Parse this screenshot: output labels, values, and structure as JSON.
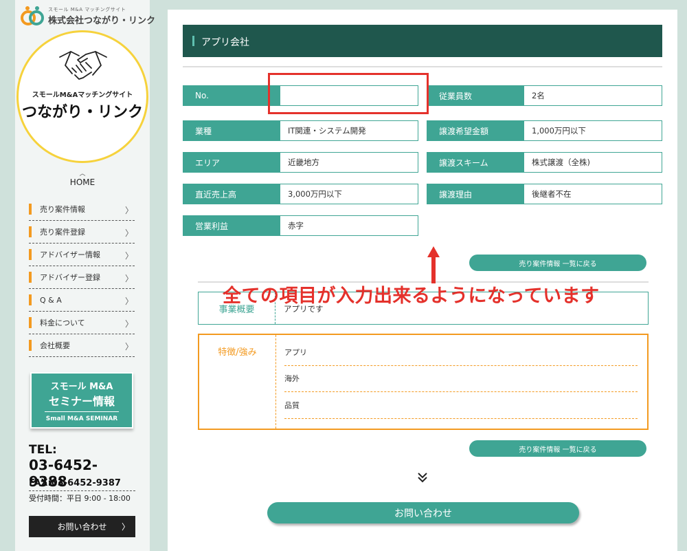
{
  "sidebar": {
    "logo_small": "スモール M&A マッチングサイト",
    "logo_name": "株式会社つながり・リンク",
    "circle_sub": "スモールM&Aマッチングサイト",
    "circle_main": "つながり・リンク",
    "home": "HOME",
    "nav": [
      {
        "label": "売り案件情報"
      },
      {
        "label": "売り案件登録"
      },
      {
        "label": "アドバイザー情報"
      },
      {
        "label": "アドバイザー登録"
      },
      {
        "label": "Q & A"
      },
      {
        "label": "料金について"
      },
      {
        "label": "会社概要"
      }
    ],
    "seminar": {
      "line1": "スモール M&A",
      "line2": "セミナー情報",
      "line3": "Small M&A SEMINAR"
    },
    "tel_label": "TEL:",
    "tel": "03-6452-9388",
    "fax": "FAX:03-6452-9387",
    "hours": "受付時間：平日 9:00 - 18:00",
    "contact": "お問い合わせ"
  },
  "main": {
    "title": "アプリ会社",
    "fields": [
      {
        "label": "No.",
        "value": ""
      },
      {
        "label": "従業員数",
        "value": "2名"
      },
      {
        "label": "業種",
        "value": "IT関連・システム開発"
      },
      {
        "label": "譲渡希望金額",
        "value": "1,000万円以下"
      },
      {
        "label": "エリア",
        "value": "近畿地方"
      },
      {
        "label": "譲渡スキーム",
        "value": "株式譲渡（全株)"
      },
      {
        "label": "直近売上高",
        "value": "3,000万円以下"
      },
      {
        "label": "譲渡理由",
        "value": "後継者不在"
      },
      {
        "label": "営業利益",
        "value": "赤字"
      }
    ],
    "back_link": "売り案件情報 一覧に戻る",
    "description": {
      "label": "事業概要",
      "value": "アプリです"
    },
    "features": {
      "label": "特徴/強み",
      "items": [
        "アプリ",
        "海外",
        "品質"
      ]
    },
    "contact_button": "お問い合わせ"
  },
  "annotation": {
    "text": "全ての項目が入力出来るようになっています",
    "color": "#e4312b"
  },
  "colors": {
    "accent": "#3fa594",
    "title_bar": "#1f574d",
    "orange": "#f39a20",
    "logo_ring": "#f6d23c"
  }
}
